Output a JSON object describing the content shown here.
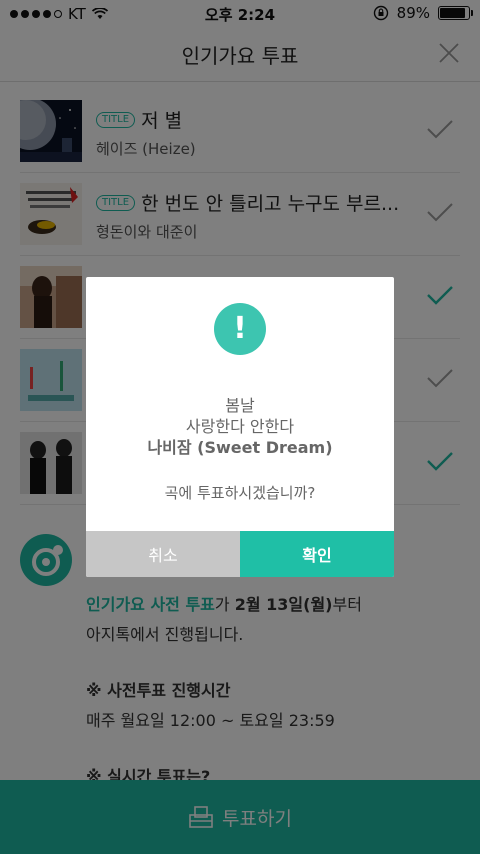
{
  "status_bar": {
    "carrier": "KT",
    "time": "오후 2:24",
    "battery_percent": "89%",
    "battery_level": 0.89,
    "signal_bars": 4
  },
  "header": {
    "title": "인기가요 투표"
  },
  "songs": [
    {
      "badge": "TITLE",
      "title": "저 별",
      "artist": "헤이즈 (Heize)",
      "selected": false
    },
    {
      "badge": "TITLE",
      "title": "한 번도 안 틀리고 누구도 부르...",
      "artist": "형돈이와 대준이",
      "selected": false
    },
    {
      "badge": "",
      "title": "",
      "artist": "",
      "selected": true
    },
    {
      "badge": "",
      "title": "",
      "artist": "",
      "selected": false
    },
    {
      "badge": "",
      "title": "",
      "artist": "",
      "selected": true
    }
  ],
  "info": {
    "line1_hl": "인기가요 사전 투표",
    "line1_mid": "가 ",
    "line1_bold": "2월 13일(월)",
    "line1_end": "부터",
    "line2": "아지톡에서 진행됩니다.",
    "section1_title": "※ 사전투표 진행시간",
    "section1_body": "매주 월요일 12:00 ~ 토요일 23:59",
    "section2_title": "※ 실시간 투표는?"
  },
  "bottom_bar": {
    "label": "투표하기"
  },
  "dialog": {
    "icon_text": "!",
    "song1": "봄날",
    "song2": "사랑한다 안한다",
    "song3": "나비잠 (Sweet Dream)",
    "question": "곡에 투표하시겠습니까?",
    "cancel_label": "취소",
    "confirm_label": "확인"
  },
  "colors": {
    "accent": "#1fb8a2",
    "check_inactive": "#9a9a9a",
    "cancel_button": "#c6c6c6"
  }
}
